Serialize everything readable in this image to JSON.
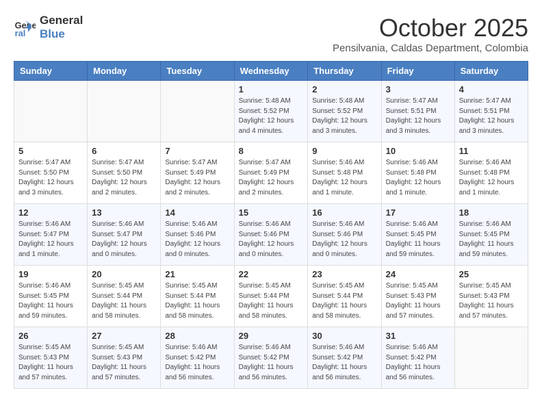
{
  "logo": {
    "line1": "General",
    "line2": "Blue"
  },
  "title": "October 2025",
  "subtitle": "Pensilvania, Caldas Department, Colombia",
  "header_days": [
    "Sunday",
    "Monday",
    "Tuesday",
    "Wednesday",
    "Thursday",
    "Friday",
    "Saturday"
  ],
  "weeks": [
    [
      {
        "day": "",
        "info": ""
      },
      {
        "day": "",
        "info": ""
      },
      {
        "day": "",
        "info": ""
      },
      {
        "day": "1",
        "info": "Sunrise: 5:48 AM\nSunset: 5:52 PM\nDaylight: 12 hours\nand 4 minutes."
      },
      {
        "day": "2",
        "info": "Sunrise: 5:48 AM\nSunset: 5:52 PM\nDaylight: 12 hours\nand 3 minutes."
      },
      {
        "day": "3",
        "info": "Sunrise: 5:47 AM\nSunset: 5:51 PM\nDaylight: 12 hours\nand 3 minutes."
      },
      {
        "day": "4",
        "info": "Sunrise: 5:47 AM\nSunset: 5:51 PM\nDaylight: 12 hours\nand 3 minutes."
      }
    ],
    [
      {
        "day": "5",
        "info": "Sunrise: 5:47 AM\nSunset: 5:50 PM\nDaylight: 12 hours\nand 3 minutes."
      },
      {
        "day": "6",
        "info": "Sunrise: 5:47 AM\nSunset: 5:50 PM\nDaylight: 12 hours\nand 2 minutes."
      },
      {
        "day": "7",
        "info": "Sunrise: 5:47 AM\nSunset: 5:49 PM\nDaylight: 12 hours\nand 2 minutes."
      },
      {
        "day": "8",
        "info": "Sunrise: 5:47 AM\nSunset: 5:49 PM\nDaylight: 12 hours\nand 2 minutes."
      },
      {
        "day": "9",
        "info": "Sunrise: 5:46 AM\nSunset: 5:48 PM\nDaylight: 12 hours\nand 1 minute."
      },
      {
        "day": "10",
        "info": "Sunrise: 5:46 AM\nSunset: 5:48 PM\nDaylight: 12 hours\nand 1 minute."
      },
      {
        "day": "11",
        "info": "Sunrise: 5:46 AM\nSunset: 5:48 PM\nDaylight: 12 hours\nand 1 minute."
      }
    ],
    [
      {
        "day": "12",
        "info": "Sunrise: 5:46 AM\nSunset: 5:47 PM\nDaylight: 12 hours\nand 1 minute."
      },
      {
        "day": "13",
        "info": "Sunrise: 5:46 AM\nSunset: 5:47 PM\nDaylight: 12 hours\nand 0 minutes."
      },
      {
        "day": "14",
        "info": "Sunrise: 5:46 AM\nSunset: 5:46 PM\nDaylight: 12 hours\nand 0 minutes."
      },
      {
        "day": "15",
        "info": "Sunrise: 5:46 AM\nSunset: 5:46 PM\nDaylight: 12 hours\nand 0 minutes."
      },
      {
        "day": "16",
        "info": "Sunrise: 5:46 AM\nSunset: 5:46 PM\nDaylight: 12 hours\nand 0 minutes."
      },
      {
        "day": "17",
        "info": "Sunrise: 5:46 AM\nSunset: 5:45 PM\nDaylight: 11 hours\nand 59 minutes."
      },
      {
        "day": "18",
        "info": "Sunrise: 5:46 AM\nSunset: 5:45 PM\nDaylight: 11 hours\nand 59 minutes."
      }
    ],
    [
      {
        "day": "19",
        "info": "Sunrise: 5:46 AM\nSunset: 5:45 PM\nDaylight: 11 hours\nand 59 minutes."
      },
      {
        "day": "20",
        "info": "Sunrise: 5:45 AM\nSunset: 5:44 PM\nDaylight: 11 hours\nand 58 minutes."
      },
      {
        "day": "21",
        "info": "Sunrise: 5:45 AM\nSunset: 5:44 PM\nDaylight: 11 hours\nand 58 minutes."
      },
      {
        "day": "22",
        "info": "Sunrise: 5:45 AM\nSunset: 5:44 PM\nDaylight: 11 hours\nand 58 minutes."
      },
      {
        "day": "23",
        "info": "Sunrise: 5:45 AM\nSunset: 5:44 PM\nDaylight: 11 hours\nand 58 minutes."
      },
      {
        "day": "24",
        "info": "Sunrise: 5:45 AM\nSunset: 5:43 PM\nDaylight: 11 hours\nand 57 minutes."
      },
      {
        "day": "25",
        "info": "Sunrise: 5:45 AM\nSunset: 5:43 PM\nDaylight: 11 hours\nand 57 minutes."
      }
    ],
    [
      {
        "day": "26",
        "info": "Sunrise: 5:45 AM\nSunset: 5:43 PM\nDaylight: 11 hours\nand 57 minutes."
      },
      {
        "day": "27",
        "info": "Sunrise: 5:45 AM\nSunset: 5:43 PM\nDaylight: 11 hours\nand 57 minutes."
      },
      {
        "day": "28",
        "info": "Sunrise: 5:46 AM\nSunset: 5:42 PM\nDaylight: 11 hours\nand 56 minutes."
      },
      {
        "day": "29",
        "info": "Sunrise: 5:46 AM\nSunset: 5:42 PM\nDaylight: 11 hours\nand 56 minutes."
      },
      {
        "day": "30",
        "info": "Sunrise: 5:46 AM\nSunset: 5:42 PM\nDaylight: 11 hours\nand 56 minutes."
      },
      {
        "day": "31",
        "info": "Sunrise: 5:46 AM\nSunset: 5:42 PM\nDaylight: 11 hours\nand 56 minutes."
      },
      {
        "day": "",
        "info": ""
      }
    ]
  ]
}
